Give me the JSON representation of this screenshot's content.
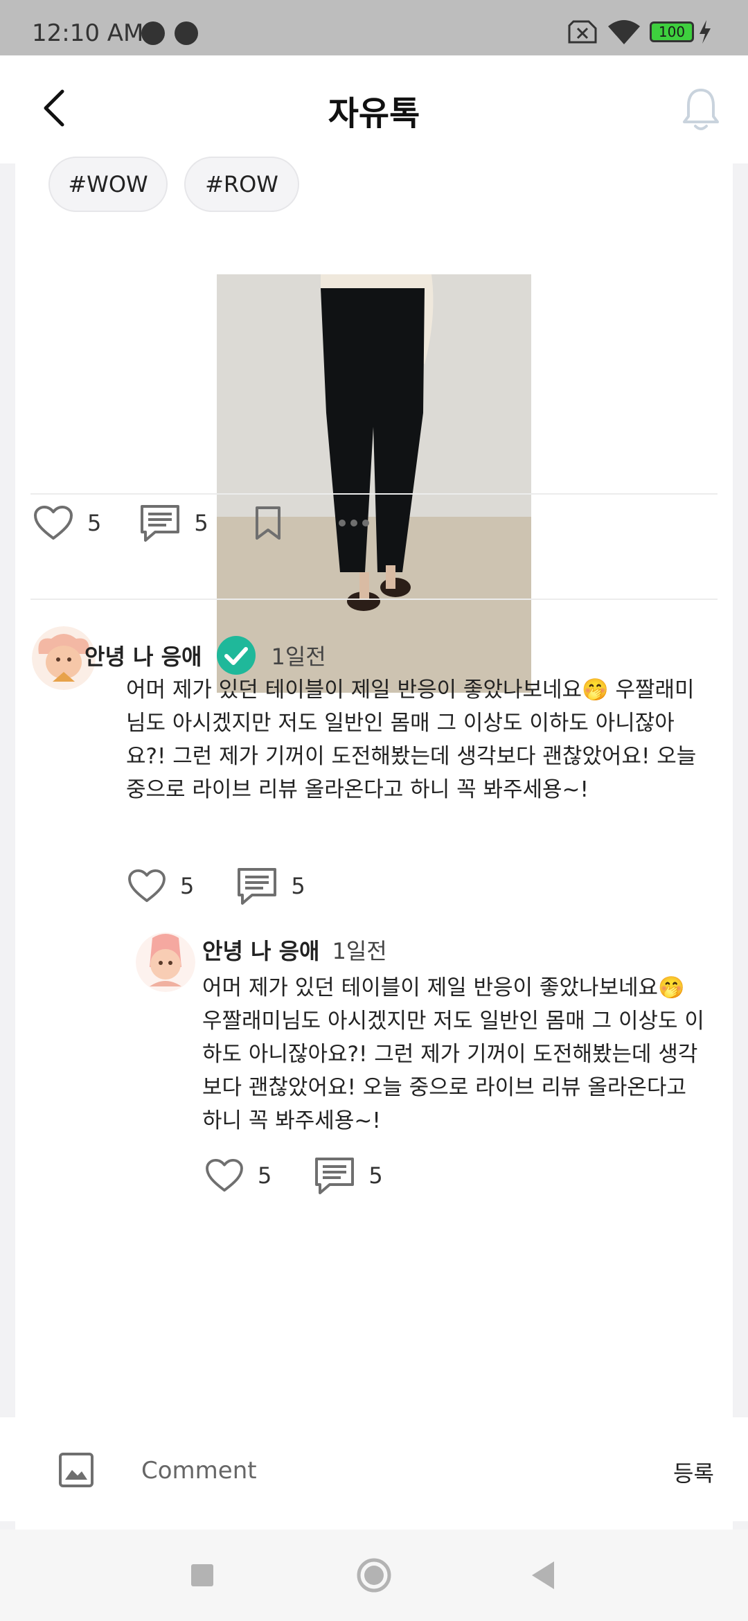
{
  "status_bar": {
    "time": "12:10 AM",
    "battery": "100",
    "icons": [
      "notification-icon",
      "notification-icon",
      "no-sim-icon",
      "wifi-icon",
      "battery-icon",
      "charging-icon"
    ]
  },
  "header": {
    "title": "자유톡",
    "back_icon": "chevron-left-icon",
    "bell_icon": "bell-icon"
  },
  "post": {
    "tags": [
      "#WOW",
      "#ROW"
    ],
    "likes": "5",
    "comments": "5"
  },
  "comments": [
    {
      "author": "안녕 나 응애",
      "time": "1일전",
      "verified": true,
      "text": "어머 제가 있던 테이블이 제일 반응이 좋았나보네요🤭 우짤래미님도 아시겠지만 저도 일반인 몸매 그 이상도 이하도 아니잖아요?! 그런 제가 기꺼이 도전해봤는데 생각보다 괜찮았어요! 오늘 중으로 라이브 리뷰 올라온다고 하니 꼭 봐주세용~!",
      "likes": "5",
      "replies": "5"
    },
    {
      "author": "안녕 나 응애",
      "time": "1일전",
      "verified": false,
      "text": "어머 제가 있던 테이블이 제일 반응이 좋았나보네요🤭 우짤래미님도 아시겠지만 저도 일반인 몸매 그 이상도 이하도 아니잖아요?! 그런 제가 기꺼이 도전해봤는데 생각보다 괜찮았어요! 오늘 중으로 라이브 리뷰 올라온다고 하니 꼭 봐주세용~!",
      "likes": "5",
      "replies": "5"
    }
  ],
  "comment_bar": {
    "placeholder": "Comment",
    "submit_label": "등록"
  },
  "colors": {
    "verified": "#1fb89a",
    "icon_gray": "#6f6f6f",
    "status_bar": "#bdbdbd"
  }
}
